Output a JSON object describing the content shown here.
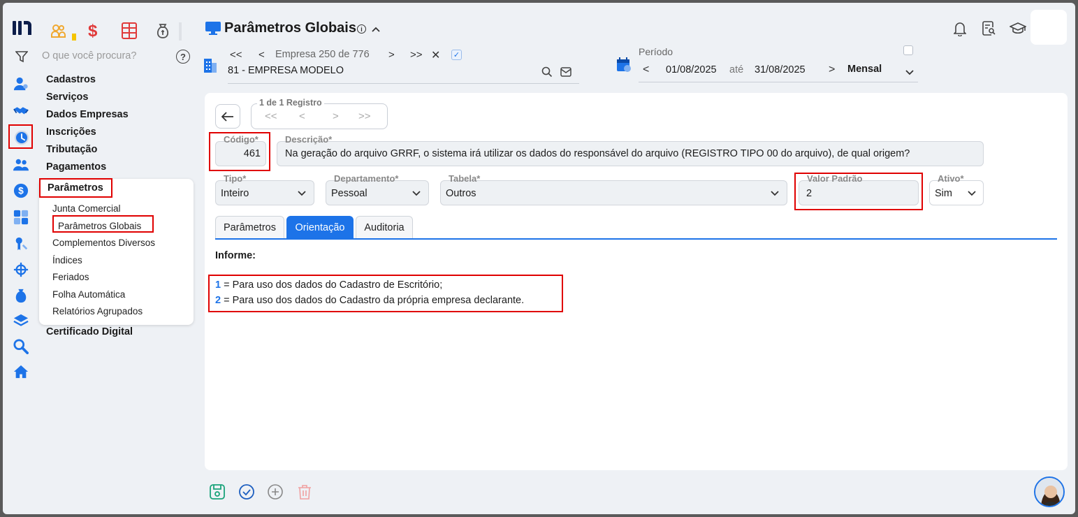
{
  "sidebar": {
    "search_placeholder": "O que você procura?",
    "rail_icons": [
      "cadastros-icon",
      "servicos-icon",
      "dados-empresas-icon",
      "inscricoes-icon",
      "tributacao-icon",
      "pagamentos-icon",
      "parametros-icon",
      "certificado-icon",
      "network-icon",
      "bag-icon",
      "layers-icon",
      "search-icon",
      "home-icon"
    ],
    "categories": {
      "cadastros": "Cadastros",
      "servicos": "Serviços",
      "dados_empresas": "Dados Empresas",
      "inscricoes": "Inscrições",
      "tributacao": "Tributação",
      "pagamentos": "Pagamentos",
      "parametros": "Parâmetros",
      "certificado": "Certificado Digital"
    },
    "submenu": [
      "Junta Comercial",
      "Parâmetros Globais",
      "Complementos Diversos",
      "Índices",
      "Feriados",
      "Folha Automática",
      "Relatórios Agrupados"
    ]
  },
  "header": {
    "title": "Parâmetros Globais",
    "empresa_nav": {
      "label": "Empresa",
      "current": "250",
      "sep": "de",
      "total": "776"
    },
    "empresa_name": "81 - EMPRESA MODELO",
    "periodo": {
      "label": "Período",
      "start": "01/08/2025",
      "sep": "até",
      "end": "31/08/2025",
      "mode": "Mensal"
    }
  },
  "form": {
    "registro": "1 de 1 Registro",
    "codigo": {
      "label": "Código*",
      "value": "461"
    },
    "descricao": {
      "label": "Descrição*",
      "value": "Na geração do arquivo GRRF, o sistema irá utilizar os dados do responsável do arquivo (REGISTRO TIPO 00 do arquivo), de qual origem?"
    },
    "tipo": {
      "label": "Tipo*",
      "value": "Inteiro"
    },
    "departamento": {
      "label": "Departamento*",
      "value": "Pessoal"
    },
    "tabela": {
      "label": "Tabela*",
      "value": "Outros"
    },
    "valor_padrao": {
      "label": "Valor Padrão",
      "value": "2"
    },
    "ativo": {
      "label": "Ativo*",
      "value": "Sim"
    }
  },
  "tabs": [
    "Parâmetros",
    "Orientação",
    "Auditoria"
  ],
  "orientacao": {
    "heading": "Informe:",
    "lines": [
      {
        "num": "1",
        "text": " = Para uso dos dados do Cadastro de Escritório;"
      },
      {
        "num": "2",
        "text": " = Para uso dos dados do Cadastro da própria empresa declarante."
      }
    ]
  },
  "colors": {
    "accent": "#1d73e8",
    "highlight": "#e00000"
  }
}
